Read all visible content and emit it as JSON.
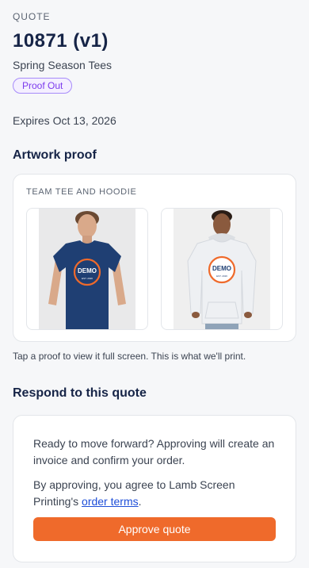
{
  "header": {
    "eyebrow": "QUOTE",
    "number": "10871 (v1)",
    "subtitle": "Spring Season Tees",
    "status": "Proof Out",
    "expires": "Expires Oct 13, 2026"
  },
  "artwork": {
    "title": "Artwork proof",
    "card_title": "TEAM TEE AND HOODIE",
    "hint": "Tap a proof to view it full screen. This is what we'll print.",
    "proofs": [
      {
        "garment": "tee",
        "logo_text": "DEMO",
        "logo_small": "EST. 2026",
        "garment_color": "#1f3f73"
      },
      {
        "garment": "hoodie",
        "logo_text": "DEMO",
        "logo_small": "EST. 2026",
        "garment_color": "#eef0f3"
      }
    ]
  },
  "respond": {
    "title": "Respond to this quote",
    "para1": "Ready to move forward? Approving will create an invoice and confirm your order.",
    "para2_prefix": "By approving, you agree to Lamb Screen Printing's ",
    "terms_link": "order terms",
    "para2_suffix": ".",
    "approve_label": "Approve quote"
  },
  "colors": {
    "accent": "#ef6a2b",
    "badge": "#7c3aed",
    "link": "#1d4ed8",
    "heading": "#162447"
  }
}
